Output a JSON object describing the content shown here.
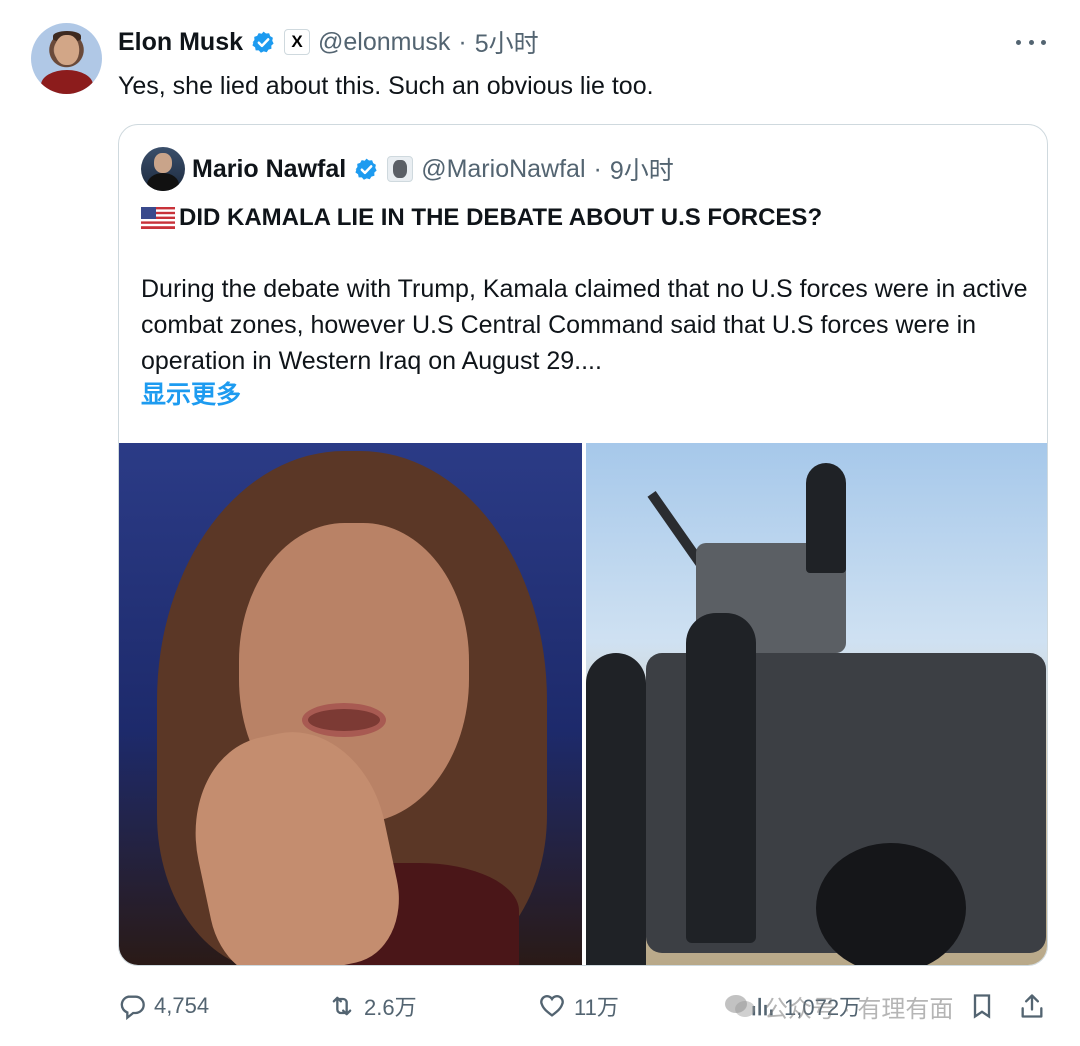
{
  "post": {
    "author": {
      "name": "Elon Musk",
      "handle": "@elonmusk",
      "separator": "·",
      "time": "5小时",
      "affiliate_badge": "X"
    },
    "text": "Yes, she lied about this. Such an obvious lie too."
  },
  "quote": {
    "author": {
      "name": "Mario Nawfal",
      "handle": "@MarioNawfal",
      "separator": "·",
      "time": "9小时"
    },
    "title": "DID KAMALA LIE IN THE DEBATE ABOUT U.S FORCES?",
    "body": "During the debate with Trump, Kamala claimed that no U.S forces were in active combat zones, however U.S Central Command said that U.S forces were in operation in Western Iraq on August 29....",
    "show_more": "显示更多"
  },
  "actions": {
    "replies": "4,754",
    "reposts": "2.6万",
    "likes": "11万",
    "views": "1,072万"
  },
  "watermark": {
    "text": "公众号 · 有理有面"
  },
  "colors": {
    "link": "#1d9bf0",
    "verified": "#1d9bf0",
    "muted": "#536471",
    "border": "#cfd9de"
  },
  "icons": [
    "verified-icon",
    "x-affiliate-icon",
    "more-icon",
    "us-flag-icon",
    "reply-icon",
    "repost-icon",
    "like-icon",
    "views-icon",
    "bookmark-icon",
    "share-icon",
    "wechat-icon"
  ]
}
